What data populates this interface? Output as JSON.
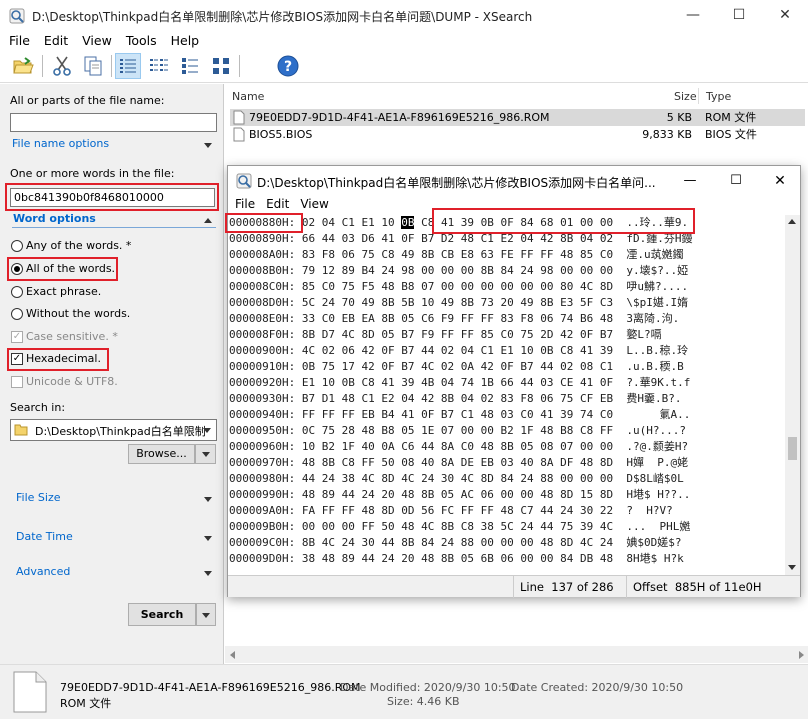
{
  "main_window": {
    "title": "D:\\Desktop\\Thinkpad白名单限制删除\\芯片修改BIOS添加网卡白名单问题\\DUMP - XSearch",
    "menu": [
      "File",
      "Edit",
      "View",
      "Tools",
      "Help"
    ]
  },
  "toolbar": {
    "icons": [
      "open-folder-icon",
      "cut-icon",
      "copy-icon",
      "details-view-icon",
      "list-view-icon",
      "small-icons-view-icon",
      "large-icons-view-icon",
      "help-icon"
    ],
    "help_glyph": "?"
  },
  "search_panel": {
    "filename_label": "All or parts of the file name:",
    "filename_value": "",
    "filename_options": "File name options",
    "words_label": "One or more words in the file:",
    "words_value": "0bc841390b0f8468010000",
    "word_options": "Word options",
    "radios": [
      {
        "label": "Any of the words.",
        "suffix": "*",
        "selected": false
      },
      {
        "label": "All of the words.",
        "suffix": "",
        "selected": true
      },
      {
        "label": "Exact phrase.",
        "suffix": "",
        "selected": false
      },
      {
        "label": "Without the words.",
        "suffix": "",
        "selected": false
      }
    ],
    "case_sensitive": {
      "label": "Case sensitive.",
      "suffix": "*",
      "checked": true,
      "disabled": true
    },
    "hexadecimal": {
      "label": "Hexadecimal.",
      "checked": true
    },
    "unicode": {
      "label": "Unicode & UTF8.",
      "checked": false,
      "disabled": true
    },
    "search_in_label": "Search in:",
    "search_in_value": "D:\\Desktop\\Thinkpad白名单限制",
    "browse_label": "Browse...",
    "sections": [
      "File Size",
      "Date Time",
      "Advanced"
    ],
    "search_button": "Search"
  },
  "file_list": {
    "columns": [
      "Name",
      "Size",
      "Type"
    ],
    "rows": [
      {
        "name": "79E0EDD7-9D1D-4F41-AE1A-F896169E5216_986.ROM",
        "size": "5 KB",
        "type": "ROM 文件",
        "selected": true
      },
      {
        "name": "BIOS5.BIOS",
        "size": "9,833 KB",
        "type": "BIOS 文件",
        "selected": false
      }
    ]
  },
  "status_bar": {
    "file_name": "79E0EDD7-9D1D-4F41-AE1A-F896169E5216_986.ROM",
    "file_type": "ROM 文件",
    "modified": "Date Modified: 2020/9/30 10:50",
    "size": "Size: 4.46 KB",
    "created": "Date Created: 2020/9/30 10:50"
  },
  "hex_viewer": {
    "title": "D:\\Desktop\\Thinkpad白名单限制删除\\芯片修改BIOS添加网卡白名单问...",
    "menu": [
      "File",
      "Edit",
      "View"
    ],
    "rows": [
      {
        "addr": "00000880H:",
        "pre": "02 04 C1 E1 10 ",
        "sel": "0B",
        "post": " C8 41 39 0B 0F 84 68 01 00 00",
        "ascii": " ..玲..華9."
      },
      {
        "addr": "00000890H:",
        "pre": "66 44 03 D6 41 0F B7 D2 48 C1 E2 04 42 8B 04 02",
        "sel": "",
        "post": "",
        "ascii": " fD.鍾.芬H鏝"
      },
      {
        "addr": "000008A0H:",
        "pre": "83 F8 06 75 C8 49 8B CB E8 63 FE FF FF 48 85 C0",
        "sel": "",
        "post": "",
        "ascii": " 凐.u茿嬎鐲"
      },
      {
        "addr": "000008B0H:",
        "pre": "79 12 89 B4 24 98 00 00 00 8B 84 24 98 00 00 00",
        "sel": "",
        "post": "",
        "ascii": " y.壊$?..婭"
      },
      {
        "addr": "000008C0H:",
        "pre": "85 C0 75 F5 48 B8 07 00 00 00 00 00 00 80 4C 8D",
        "sel": "",
        "post": "",
        "ascii": " 吚u鮄?...."
      },
      {
        "addr": "000008D0H:",
        "pre": "5C 24 70 49 8B 5B 10 49 8B 73 20 49 8B E3 5F C3",
        "sel": "",
        "post": "",
        "ascii": " \\$pI媅.I媠"
      },
      {
        "addr": "000008E0H:",
        "pre": "33 C0 EB EA 8B 05 C6 F9 FF FF 83 F8 06 74 B6 48",
        "sel": "",
        "post": "",
        "ascii": " 3离陭.泃."
      },
      {
        "addr": "000008F0H:",
        "pre": "8B D7 4C 8D 05 B7 F9 FF FF 85 C0 75 2D 42 0F B7",
        "sel": "",
        "post": "",
        "ascii": " 嬜L?嗝"
      },
      {
        "addr": "00000900H:",
        "pre": "4C 02 06 42 0F B7 44 02 04 C1 E1 10 0B C8 41 39",
        "sel": "",
        "post": "",
        "ascii": " L..B.稤.玲"
      },
      {
        "addr": "00000910H:",
        "pre": "0B 75 17 42 0F B7 4C 02 0A 42 0F B7 44 02 08 C1",
        "sel": "",
        "post": "",
        "ascii": " .u.B.稬.B"
      },
      {
        "addr": "00000920H:",
        "pre": "E1 10 0B C8 41 39 4B 04 74 1B 66 44 03 CE 41 0F",
        "sel": "",
        "post": "",
        "ascii": " ?.華9K.t.f"
      },
      {
        "addr": "00000930H:",
        "pre": "B7 D1 48 C1 E2 04 42 8B 04 02 83 F8 06 75 CF EB",
        "sel": "",
        "post": "",
        "ascii": " 费H嫑.B?."
      },
      {
        "addr": "00000940H:",
        "pre": "FF FF FF EB B4 41 0F B7 C1 48 03 C0 41 39 74 C0",
        "sel": "",
        "post": "",
        "ascii": "      氭A.."
      },
      {
        "addr": "00000950H:",
        "pre": "0C 75 28 48 B8 05 1E 07 00 00 B2 1F 48 B8 C8 FF",
        "sel": "",
        "post": "",
        "ascii": " .u(H?...?"
      },
      {
        "addr": "00000960H:",
        "pre": "10 B2 1F 40 0A C6 44 8A C0 48 8B 05 08 07 00 00",
        "sel": "",
        "post": "",
        "ascii": " .?@.颣姜H?"
      },
      {
        "addr": "00000970H:",
        "pre": "48 8B C8 FF 50 08 40 8A DE EB 03 40 8A DF 48 8D",
        "sel": "",
        "post": "",
        "ascii": " H嬋  P.@姥"
      },
      {
        "addr": "00000980H:",
        "pre": "44 24 38 4C 8D 4C 24 30 4C 8D 84 24 88 00 00 00",
        "sel": "",
        "post": "",
        "ascii": " D$8L崉$0L"
      },
      {
        "addr": "00000990H:",
        "pre": "48 89 44 24 20 48 8B 05 AC 06 00 00 48 8D 15 8D",
        "sel": "",
        "post": "",
        "ascii": " H塂$ H??.."
      },
      {
        "addr": "000009A0H:",
        "pre": "FA FF FF 48 8D 0D 56 FC FF FF 48 C7 44 24 30 22",
        "sel": "",
        "post": "",
        "ascii": " ?  H?V?  "
      },
      {
        "addr": "000009B0H:",
        "pre": "00 00 00 FF 50 48 4C 8B C8 38 5C 24 44 75 39 4C",
        "sel": "",
        "post": "",
        "ascii": " ...  PHL嬎"
      },
      {
        "addr": "000009C0H:",
        "pre": "8B 4C 24 30 44 8B 84 24 88 00 00 00 48 8D 4C 24",
        "sel": "",
        "post": "",
        "ascii": " 婰$0D嫅$?"
      },
      {
        "addr": "000009D0H:",
        "pre": "38 48 89 44 24 20 48 8B 05 6B 06 00 00 84 DB 48",
        "sel": "",
        "post": "",
        "ascii": " 8H塂$ H?k"
      }
    ],
    "status_line": "Line  137 of 286",
    "status_offset": "Offset  885H of 11e0H"
  }
}
